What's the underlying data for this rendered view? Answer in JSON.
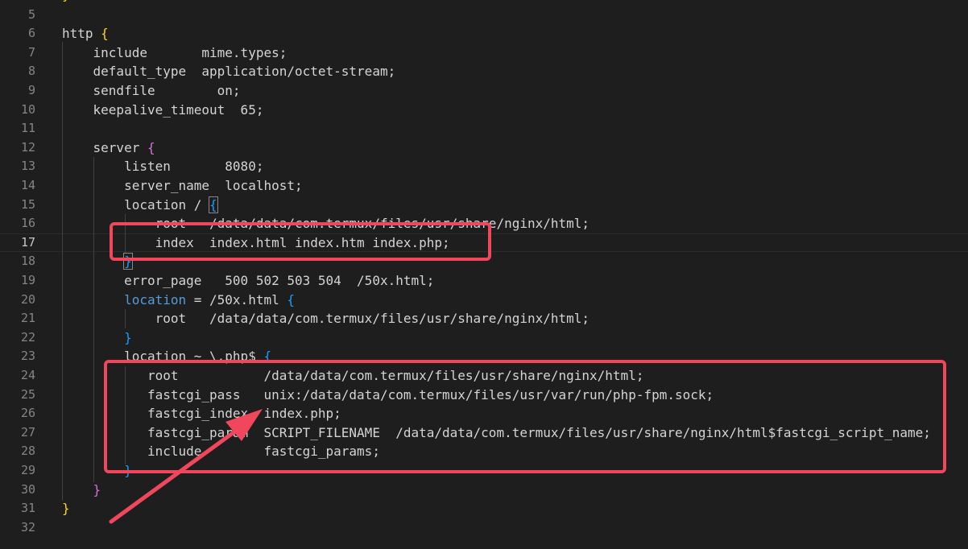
{
  "editor": {
    "current_line": 17,
    "lines": [
      {
        "n": "5",
        "segs": []
      },
      {
        "n": "6",
        "segs": [
          {
            "t": "http ",
            "c": "tok-fg"
          },
          {
            "t": "{",
            "c": "b-yellow"
          }
        ]
      },
      {
        "n": "7",
        "segs": [
          {
            "t": "    include       mime.types",
            "c": "tok-fg"
          },
          {
            "t": ";",
            "c": "tok-punc"
          }
        ]
      },
      {
        "n": "8",
        "segs": [
          {
            "t": "    default_type  application/octet-stream",
            "c": "tok-fg"
          },
          {
            "t": ";",
            "c": "tok-punc"
          }
        ]
      },
      {
        "n": "9",
        "segs": [
          {
            "t": "    sendfile        on",
            "c": "tok-fg"
          },
          {
            "t": ";",
            "c": "tok-punc"
          }
        ]
      },
      {
        "n": "10",
        "segs": [
          {
            "t": "    keepalive_timeout  65",
            "c": "tok-fg"
          },
          {
            "t": ";",
            "c": "tok-punc"
          }
        ]
      },
      {
        "n": "11",
        "segs": []
      },
      {
        "n": "12",
        "segs": [
          {
            "t": "    server ",
            "c": "tok-fg"
          },
          {
            "t": "{",
            "c": "b-magenta"
          }
        ]
      },
      {
        "n": "13",
        "segs": [
          {
            "t": "        listen       8080",
            "c": "tok-fg"
          },
          {
            "t": ";",
            "c": "tok-punc"
          }
        ]
      },
      {
        "n": "14",
        "segs": [
          {
            "t": "        server_name  localhost",
            "c": "tok-fg"
          },
          {
            "t": ";",
            "c": "tok-punc"
          }
        ]
      },
      {
        "n": "15",
        "segs": [
          {
            "t": "        location / ",
            "c": "tok-fg"
          },
          {
            "t": "{",
            "c": "b-blue b-box"
          }
        ]
      },
      {
        "n": "16",
        "segs": [
          {
            "t": "            root   /data/data/com.termux/files/usr/share/nginx/html",
            "c": "tok-fg"
          },
          {
            "t": ";",
            "c": "tok-punc"
          }
        ]
      },
      {
        "n": "17",
        "segs": [
          {
            "t": "            index  index.html index.htm index.php",
            "c": "tok-fg"
          },
          {
            "t": ";",
            "c": "tok-punc"
          }
        ]
      },
      {
        "n": "18",
        "segs": [
          {
            "t": "        ",
            "c": "tok-fg"
          },
          {
            "t": "}",
            "c": "b-blue b-box"
          }
        ]
      },
      {
        "n": "19",
        "segs": [
          {
            "t": "        error_page   500 502 503 504  /50x.html",
            "c": "tok-fg"
          },
          {
            "t": ";",
            "c": "tok-punc"
          }
        ]
      },
      {
        "n": "20",
        "segs": [
          {
            "t": "        ",
            "c": "tok-fg"
          },
          {
            "t": "location",
            "c": "kw-blue"
          },
          {
            "t": " = /50x.html ",
            "c": "tok-fg"
          },
          {
            "t": "{",
            "c": "b-blue"
          }
        ]
      },
      {
        "n": "21",
        "segs": [
          {
            "t": "            root   /data/data/com.termux/files/usr/share/nginx/html",
            "c": "tok-fg"
          },
          {
            "t": ";",
            "c": "tok-punc"
          }
        ]
      },
      {
        "n": "22",
        "segs": [
          {
            "t": "        ",
            "c": "tok-fg"
          },
          {
            "t": "}",
            "c": "b-blue"
          }
        ]
      },
      {
        "n": "23",
        "segs": [
          {
            "t": "        location ~ \\.php$ ",
            "c": "tok-fg"
          },
          {
            "t": "{",
            "c": "b-blue"
          }
        ]
      },
      {
        "n": "24",
        "segs": [
          {
            "t": "           root           /data/data/com.termux/files/usr/share/nginx/html",
            "c": "tok-fg"
          },
          {
            "t": ";",
            "c": "tok-punc"
          }
        ]
      },
      {
        "n": "25",
        "segs": [
          {
            "t": "           fastcgi_pass   unix:/data/data/com.termux/files/usr/var/run/php-fpm.sock",
            "c": "tok-fg"
          },
          {
            "t": ";",
            "c": "tok-punc"
          }
        ]
      },
      {
        "n": "26",
        "segs": [
          {
            "t": "           fastcgi_index  index.php",
            "c": "tok-fg"
          },
          {
            "t": ";",
            "c": "tok-punc"
          }
        ]
      },
      {
        "n": "27",
        "segs": [
          {
            "t": "           fastcgi_param  SCRIPT_FILENAME  /data/data/com.termux/files/usr/share/nginx/html$fastcgi_script_name",
            "c": "tok-fg"
          },
          {
            "t": ";",
            "c": "tok-punc"
          }
        ]
      },
      {
        "n": "28",
        "segs": [
          {
            "t": "           include        fastcgi_params",
            "c": "tok-fg"
          },
          {
            "t": ";",
            "c": "tok-punc"
          }
        ]
      },
      {
        "n": "29",
        "segs": [
          {
            "t": "        ",
            "c": "tok-fg"
          },
          {
            "t": "}",
            "c": "b-blue"
          }
        ]
      },
      {
        "n": "30",
        "segs": [
          {
            "t": "    ",
            "c": "tok-fg"
          },
          {
            "t": "}",
            "c": "b-magenta"
          }
        ]
      },
      {
        "n": "31",
        "segs": [
          {
            "t": "}",
            "c": "b-yellow"
          }
        ]
      },
      {
        "n": "32",
        "segs": []
      }
    ]
  },
  "top_partial_brace": "}",
  "annotations": {
    "box_color": "#f0475c",
    "arrow_color": "#f0475c"
  }
}
